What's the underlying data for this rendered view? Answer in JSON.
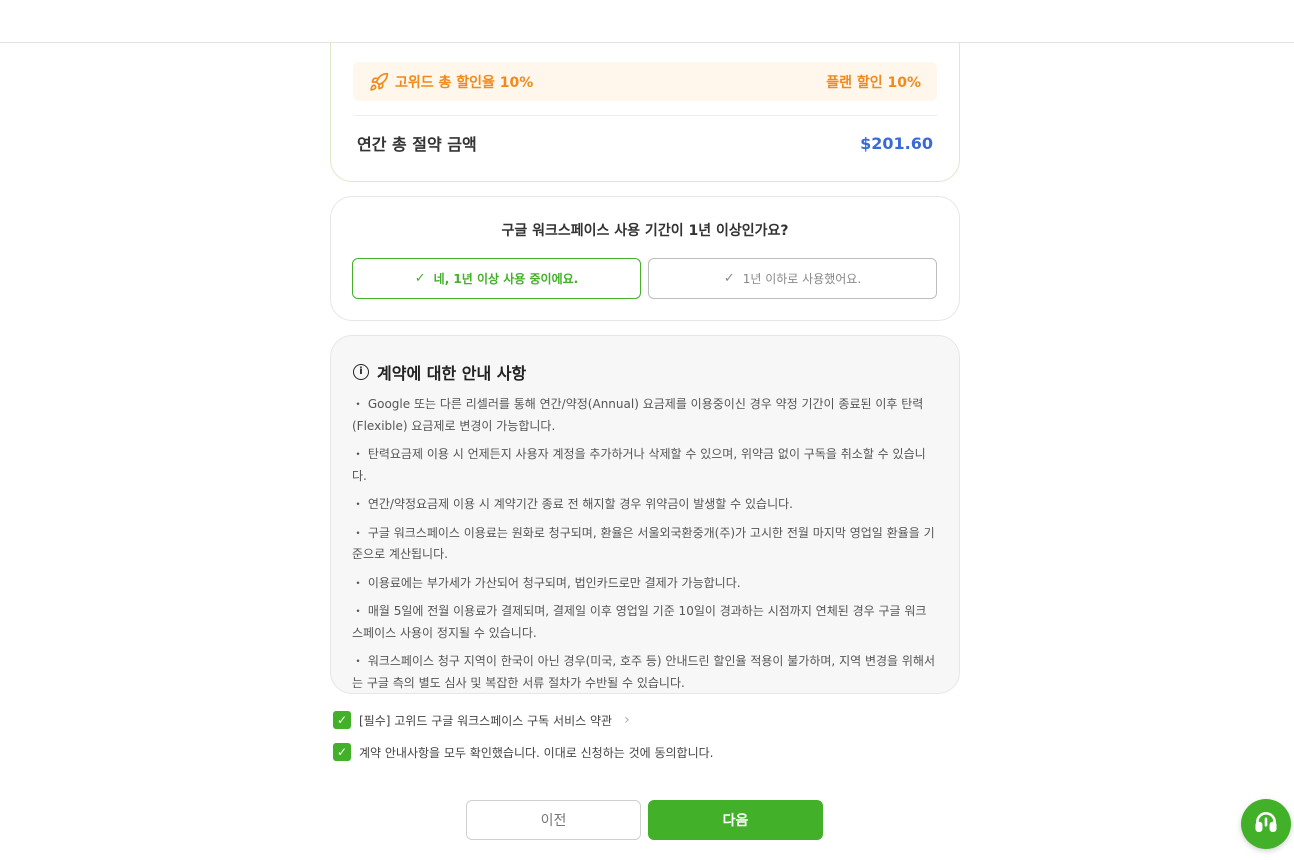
{
  "summary": {
    "discount_label": "고위드 총 할인율 10%",
    "plan_discount": "플랜 할인 10%",
    "annual_saving_label": "연간 총 절약 금액",
    "annual_saving_value": "$201.60"
  },
  "question": {
    "title": "구글 워크스페이스 사용 기간이 1년 이상인가요?",
    "option_yes": "네, 1년 이상 사용 중이에요.",
    "option_no": "1년 이하로 사용했어요."
  },
  "notice": {
    "title": "계약에 대한 안내 사항",
    "items": [
      "・ Google 또는 다른 리셀러를 통해 연간/약정(Annual) 요금제를 이용중이신 경우 약정 기간이 종료된 이후 탄력(Flexible) 요금제로 변경이 가능합니다.",
      "・ 탄력요금제 이용 시 언제든지 사용자 계정을 추가하거나 삭제할 수 있으며, 위약금 없이 구독을 취소할 수 있습니다.",
      "・ 연간/약정요금제 이용 시 계약기간 종료 전 해지할 경우 위약금이 발생할 수 있습니다.",
      "・ 구글 워크스페이스 이용료는 원화로 청구되며, 환율은 서울외국환중개(주)가 고시한 전월 마지막 영업일 환율을 기준으로 계산됩니다.",
      "・ 이용료에는 부가세가 가산되어 청구되며, 법인카드로만 결제가 가능합니다.",
      "・ 매월 5일에 전월 이용료가 결제되며, 결제일 이후 영업일 기준 10일이 경과하는 시점까지 연체된 경우 구글 워크스페이스 사용이 정지될 수 있습니다.",
      "・ 워크스페이스 청구 지역이 한국이 아닌 경우(미국, 호주 등) 안내드린 할인율 적용이 불가하며, 지역 변경을 위해서는 구글 측의 별도 심사 및 복잡한 서류 절차가 수반될 수 있습니다."
    ]
  },
  "agreements": {
    "terms": "[필수] 고위드 구글 워크스페이스 구독 서비스 약관",
    "confirm": "계약 안내사항을 모두 확인했습니다. 이대로 신청하는 것에 동의합니다."
  },
  "buttons": {
    "prev": "이전",
    "next": "다음"
  },
  "icons": {
    "rocket": "rocket-icon",
    "info": "info-icon",
    "check": "check-icon",
    "chevron": "chevron-right-icon",
    "support": "headset-icon"
  },
  "colors": {
    "accent": "#43b02a",
    "discount": "#f08a1c",
    "saving": "#3a6ad6"
  }
}
